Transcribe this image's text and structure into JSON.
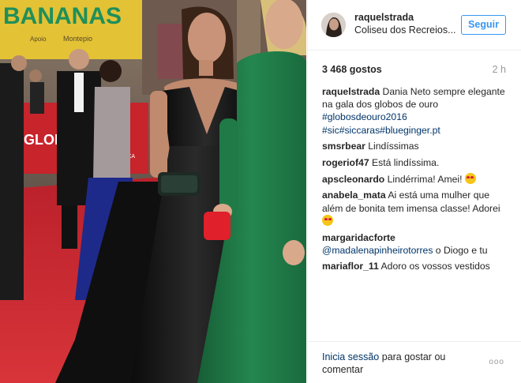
{
  "photo": {
    "sign_text": "BANANAS",
    "sign_small": "Apoio",
    "sign_sponsor": "Montepio",
    "backdrop_text": "GLOBOS",
    "backdrop_small": "CAIXA"
  },
  "post": {
    "username": "raquelstrada",
    "location": "Coliseu dos Recreios...",
    "follow_label": "Seguir",
    "likes": "3 468 gostos",
    "time_ago": "2 h"
  },
  "caption": {
    "username": "raquelstrada",
    "text": "Dania Neto sempre elegante na gala dos globos de ouro ",
    "tags": [
      "#globosdeouro2016",
      "#sic",
      "#siccaras",
      "#blueginger.pt"
    ]
  },
  "comments": [
    {
      "username": "smsrbear",
      "text": "Lindíssimas"
    },
    {
      "username": "rogeriof47",
      "text": "Está lindíssima."
    },
    {
      "username": "apscleonardo",
      "text": "Lindérrima! Amei! "
    },
    {
      "username": "anabela_mata",
      "text": "Ai está uma mulher que além de bonita tem imensa classe! Adorei "
    },
    {
      "username": "margaridacforte",
      "mention": "@madalenapinheirotorres",
      "text": " o Diogo e tu"
    },
    {
      "username": "mariaflor_11",
      "text": "Adoro os vossos vestidos"
    }
  ],
  "footer": {
    "login_link": "Inicia sessão",
    "login_text": " para gostar ou comentar",
    "more_label": "ooo"
  },
  "colors": {
    "accent": "#3897f0",
    "hashtag": "#003569",
    "muted": "#999999",
    "carpet": "#c8222a",
    "black_dress": "#141414",
    "green_dress": "#1f7a47",
    "clutch_red": "#e0202a"
  }
}
